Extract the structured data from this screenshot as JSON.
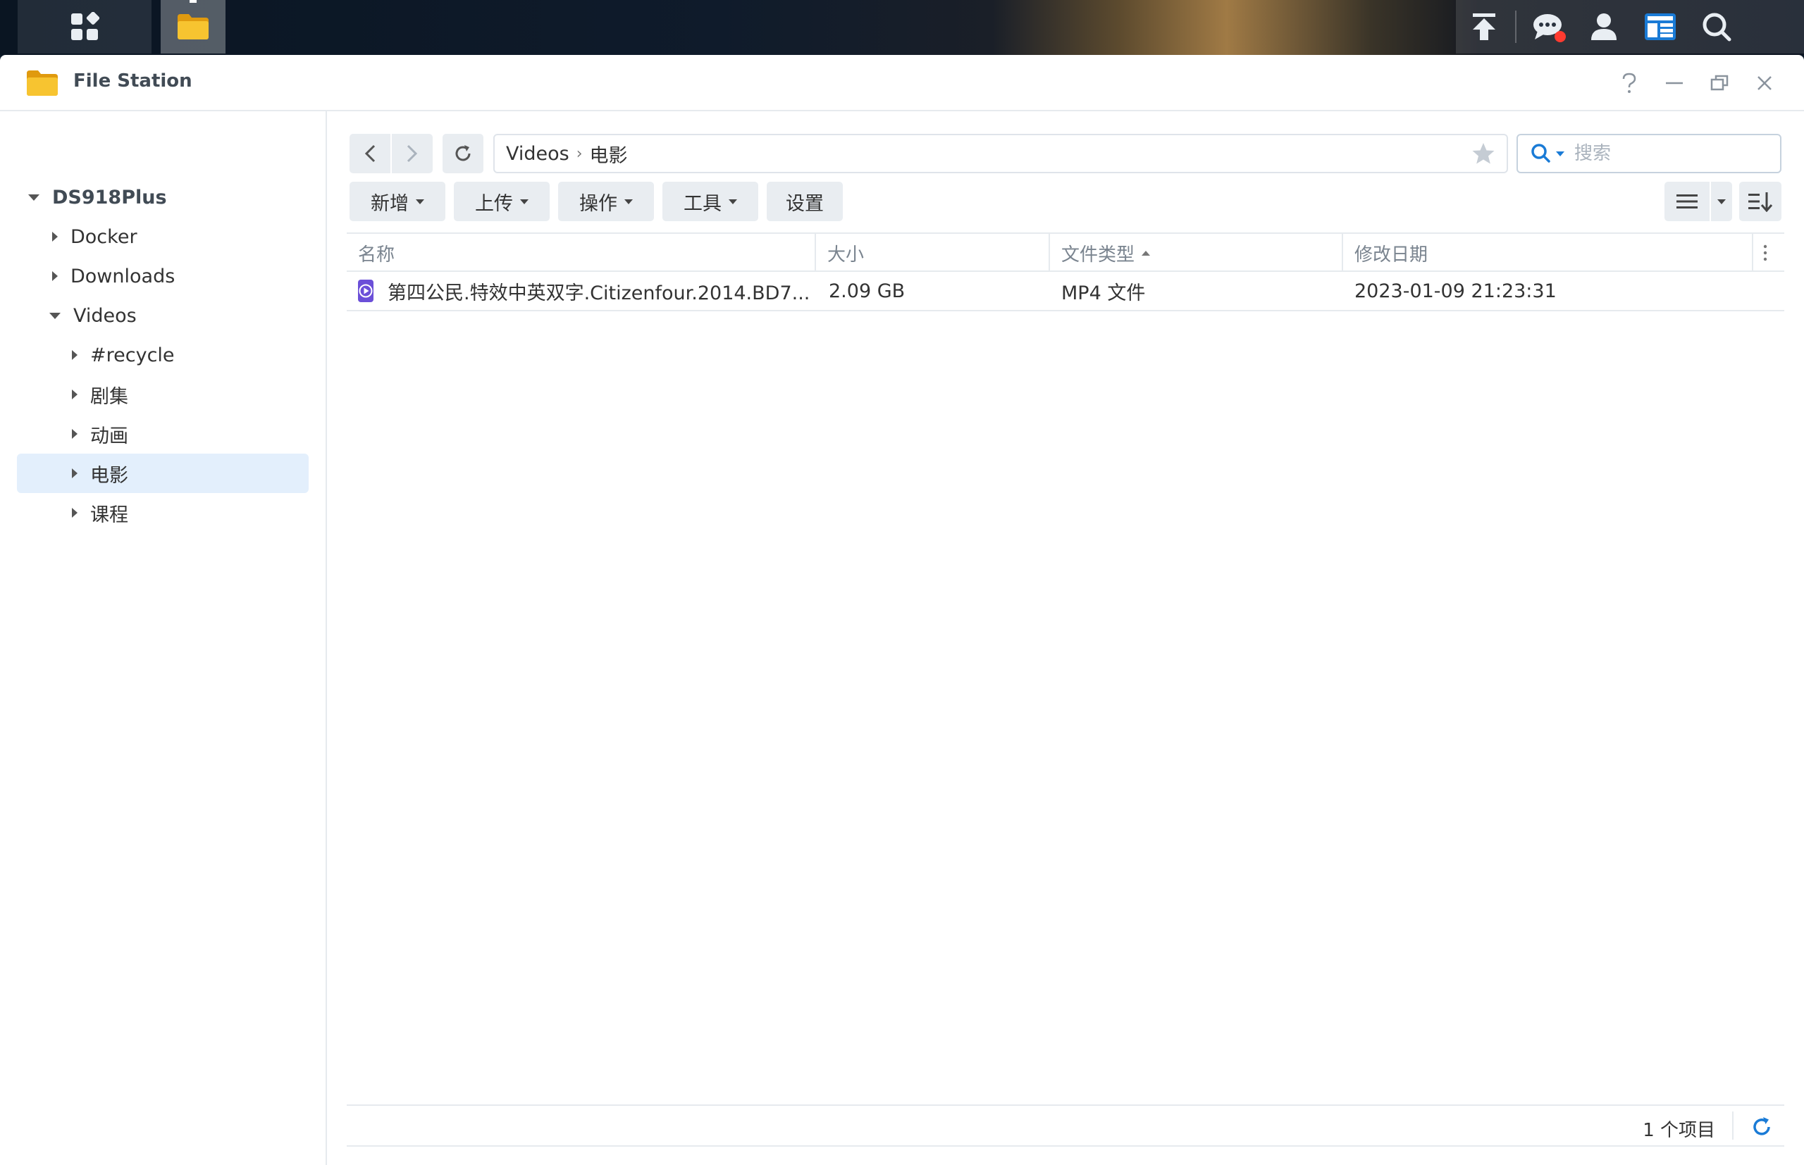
{
  "window": {
    "title": "File Station"
  },
  "sidebar": {
    "root": "DS918Plus",
    "items": [
      {
        "label": "Docker"
      },
      {
        "label": "Downloads"
      },
      {
        "label": "Videos"
      },
      {
        "label": "#recycle"
      },
      {
        "label": "剧集"
      },
      {
        "label": "动画"
      },
      {
        "label": "电影"
      },
      {
        "label": "课程"
      }
    ]
  },
  "path": {
    "segments": [
      "Videos",
      "电影"
    ]
  },
  "search": {
    "placeholder": "搜索"
  },
  "toolbar": {
    "create": "新增",
    "upload": "上传",
    "action": "操作",
    "tools": "工具",
    "settings": "设置"
  },
  "table": {
    "columns": {
      "name": "名称",
      "size": "大小",
      "type": "文件类型",
      "modified": "修改日期"
    },
    "rows": [
      {
        "name": "第四公民.特效中英双字.Citizenfour.2014.BD7...",
        "size": "2.09 GB",
        "type": "MP4 文件",
        "modified": "2023-01-09 21:23:31"
      }
    ]
  },
  "status": {
    "count": "1 个项目"
  },
  "colors": {
    "accent": "#1a7bd6",
    "selected_bg": "#e3effc",
    "video_icon": "#6b4fd8",
    "folder": "#f5b820",
    "notification": "#ff3b30"
  }
}
